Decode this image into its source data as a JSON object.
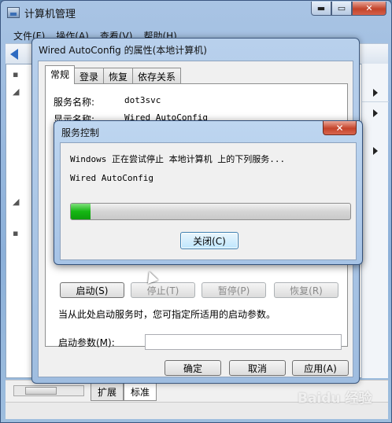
{
  "main_window": {
    "title": "计算机管理",
    "menu": [
      "文件(F)",
      "操作(A)",
      "查看(V)",
      "帮助(H)"
    ],
    "caption": {
      "minimize": "▬",
      "maximize": "▭",
      "close": "✕"
    },
    "view_tabs": [
      "扩展",
      "标准"
    ]
  },
  "properties_dialog": {
    "title": "Wired AutoConfig 的属性(本地计算机)",
    "tabs": [
      "常规",
      "登录",
      "恢复",
      "依存关系"
    ],
    "service_name_label": "服务名称:",
    "service_name_value": "dot3svc",
    "display_name_label": "显示名称:",
    "display_name_value": "Wired AutoConfig",
    "buttons": {
      "start": "启动(S)",
      "stop": "停止(T)",
      "pause": "暂停(P)",
      "resume": "恢复(R)"
    },
    "hint": "当从此处启动服务时，您可指定所适用的启动参数。",
    "start_params_label": "启动参数(M):",
    "start_params_value": "",
    "ok": "确定",
    "cancel": "取消",
    "apply": "应用(A)"
  },
  "service_control": {
    "title": "服务控制",
    "close_glyph": "✕",
    "message": "Windows 正在尝试停止 本地计算机 上的下列服务...",
    "service": "Wired AutoConfig",
    "progress": 0.07,
    "close_button": "关闭(C)"
  },
  "watermark": "Baidu 经验"
}
